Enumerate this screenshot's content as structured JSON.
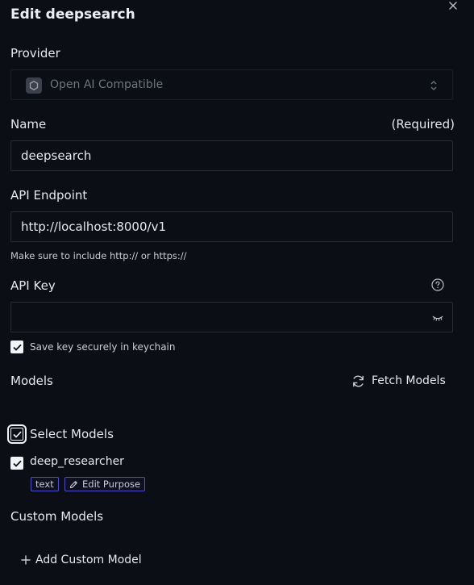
{
  "dialog": {
    "title": "Edit deepsearch"
  },
  "provider": {
    "label": "Provider",
    "value": "Open AI Compatible"
  },
  "name": {
    "label": "Name",
    "required_text": "(Required)",
    "value": "deepsearch"
  },
  "endpoint": {
    "label": "API Endpoint",
    "value": "http://localhost:8000/v1",
    "hint": "Make sure to include http:// or https://"
  },
  "api_key": {
    "label": "API Key",
    "value": "",
    "save_keychain_label": "Save key securely in keychain"
  },
  "models": {
    "label": "Models",
    "fetch_label": "Fetch Models",
    "select_all_label": "Select Models",
    "items": [
      {
        "name": "deep_researcher",
        "tag": "text",
        "edit_purpose_label": "Edit Purpose"
      }
    ]
  },
  "custom_models": {
    "label": "Custom Models",
    "add_label": "Add Custom Model"
  }
}
